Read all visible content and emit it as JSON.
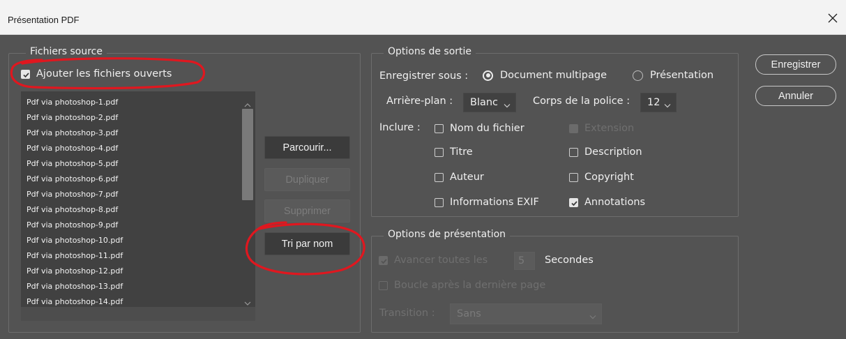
{
  "window": {
    "title": "Présentation PDF"
  },
  "source": {
    "legend": "Fichiers source",
    "add_open_files": "Ajouter les fichiers ouverts",
    "files": [
      "Pdf via photoshop-1.pdf",
      "Pdf via photoshop-2.pdf",
      "Pdf via photoshop-3.pdf",
      "Pdf via photoshop-4.pdf",
      "Pdf via photoshop-5.pdf",
      "Pdf via photoshop-6.pdf",
      "Pdf via photoshop-7.pdf",
      "Pdf via photoshop-8.pdf",
      "Pdf via photoshop-9.pdf",
      "Pdf via photoshop-10.pdf",
      "Pdf via photoshop-11.pdf",
      "Pdf via photoshop-12.pdf",
      "Pdf via photoshop-13.pdf",
      "Pdf via photoshop-14.pdf"
    ],
    "buttons": {
      "browse": "Parcourir...",
      "duplicate": "Dupliquer",
      "remove": "Supprimer",
      "sort": "Tri par nom"
    }
  },
  "output": {
    "legend": "Options de sortie",
    "save_as_label": "Enregistrer sous :",
    "mode_multipage": "Document multipage",
    "mode_presentation": "Présentation",
    "background_label": "Arrière-plan :",
    "background_value": "Blanc",
    "font_size_label": "Corps de la police :",
    "font_size_value": "12",
    "include_label": "Inclure :",
    "opt_filename": "Nom du fichier",
    "opt_extension": "Extension",
    "opt_title": "Titre",
    "opt_description": "Description",
    "opt_author": "Auteur",
    "opt_copyright": "Copyright",
    "opt_exif": "Informations EXIF",
    "opt_annotations": "Annotations"
  },
  "presentation": {
    "legend": "Options de présentation",
    "advance_label": "Avancer toutes les",
    "advance_value": "5",
    "seconds_label": "Secondes",
    "loop_label": "Boucle après la dernière page",
    "transition_label": "Transition :",
    "transition_value": "Sans"
  },
  "actions": {
    "save": "Enregistrer",
    "cancel": "Annuler"
  },
  "colors": {
    "panel": "#535353",
    "field": "#414141",
    "annotation": "#e0171f"
  }
}
